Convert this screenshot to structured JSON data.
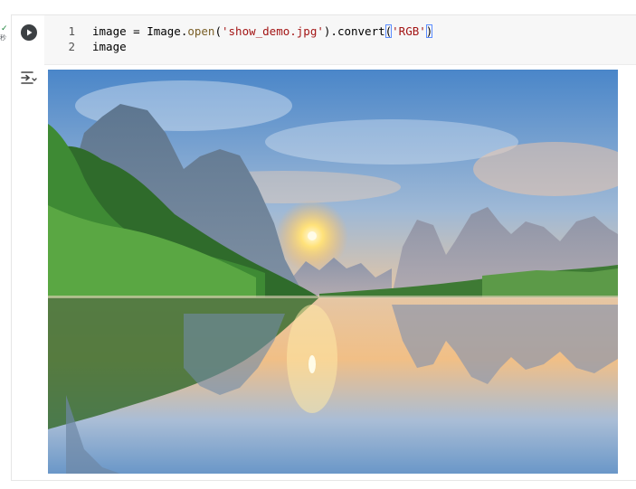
{
  "status": {
    "check": "✓",
    "duration": "秒"
  },
  "code": {
    "lines": [
      {
        "num": "1",
        "t0": "image = Image.",
        "t1": "open",
        "t2": "(",
        "t3": "'show_demo.jpg'",
        "t4": ").convert",
        "t5": "(",
        "t6": "'RGB'",
        "t7": ")"
      },
      {
        "num": "2",
        "t0": "image"
      }
    ]
  },
  "colors": {
    "run_button": "#3c4043",
    "string": "#a31515",
    "function": "#795e26",
    "bracket_highlight": "#5b8cff",
    "editor_bg": "#f7f7f7"
  },
  "icons": {
    "run": "play-icon",
    "output": "output-toggle-icon",
    "status": "checkmark-icon"
  },
  "output": {
    "type": "image",
    "description_visible": false
  }
}
